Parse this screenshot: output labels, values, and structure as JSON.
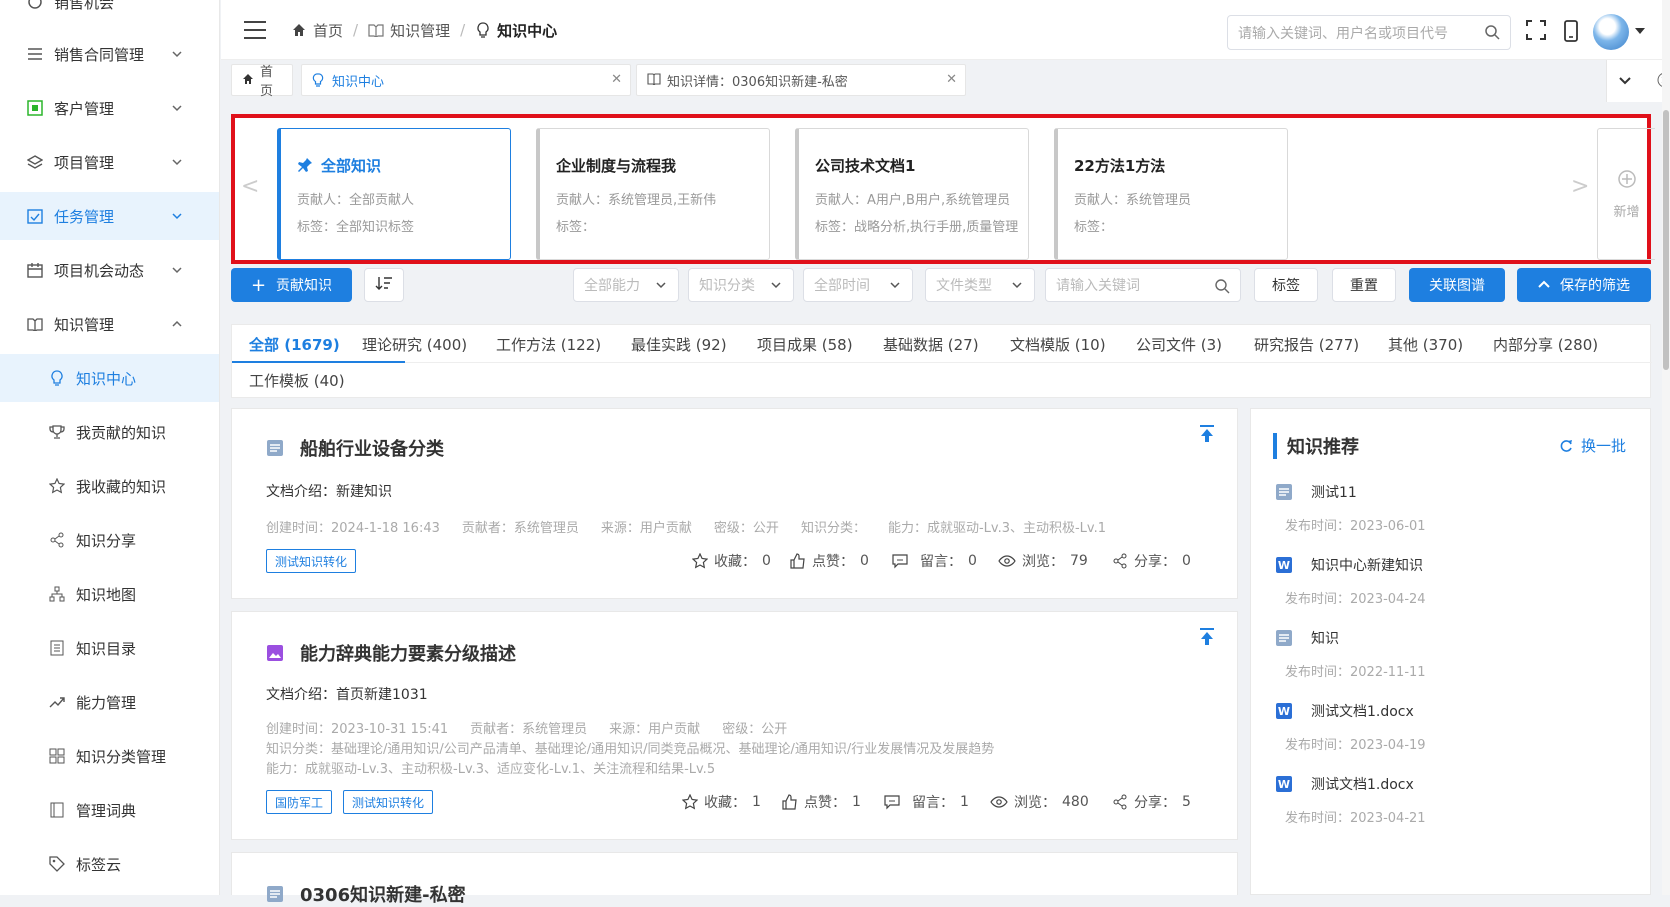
{
  "sidebar": {
    "items": [
      {
        "label": "销售机会",
        "icon": "circle-icon"
      },
      {
        "label": "销售合同管理",
        "icon": "list-icon"
      },
      {
        "label": "客户管理",
        "icon": "customer-icon"
      },
      {
        "label": "项目管理",
        "icon": "layers-icon"
      },
      {
        "label": "任务管理",
        "icon": "task-icon"
      },
      {
        "label": "项目机会动态",
        "icon": "calendar-icon"
      },
      {
        "label": "知识管理",
        "icon": "book-icon"
      }
    ],
    "sub_items": [
      {
        "label": "知识中心",
        "icon": "bulb-icon"
      },
      {
        "label": "我贡献的知识",
        "icon": "trophy-icon"
      },
      {
        "label": "我收藏的知识",
        "icon": "star-icon"
      },
      {
        "label": "知识分享",
        "icon": "share-icon"
      },
      {
        "label": "知识地图",
        "icon": "sitemap-icon"
      },
      {
        "label": "知识目录",
        "icon": "catalog-icon"
      },
      {
        "label": "能力管理",
        "icon": "trend-icon"
      },
      {
        "label": "知识分类管理",
        "icon": "grid-icon"
      },
      {
        "label": "管理词典",
        "icon": "dictionary-icon"
      },
      {
        "label": "标签云",
        "icon": "tag-icon"
      }
    ]
  },
  "header": {
    "breadcrumb": [
      "首页",
      "知识管理",
      "知识中心"
    ],
    "search_placeholder": "请输入关键词、用户名或项目代号"
  },
  "tabs": [
    {
      "label": "首页"
    },
    {
      "label": "知识中心"
    },
    {
      "label": "知识详情：0306知识新建-私密"
    }
  ],
  "knowledge_bases": [
    {
      "title": "全部知识",
      "contributors": "贡献人：全部贡献人",
      "tags": "标签：全部知识标签"
    },
    {
      "title": "企业制度与流程我",
      "contributors": "贡献人：系统管理员,王新伟",
      "tags": "标签："
    },
    {
      "title": "公司技术文档1",
      "contributors": "贡献人：A用户,B用户,系统管理员",
      "tags": "标签：战略分析,执行手册,质量管理"
    },
    {
      "title": "22方法1方法",
      "contributors": "贡献人：系统管理员",
      "tags": "标签："
    }
  ],
  "kb_add_label": "新增",
  "toolbar": {
    "contribute": "贡献知识",
    "ability": "全部能力",
    "category": "知识分类",
    "time": "全部时间",
    "filetype": "文件类型",
    "keyword_placeholder": "请输入关键词",
    "tag": "标签",
    "reset": "重置",
    "graph": "关联图谱",
    "saved_filter": "保存的筛选"
  },
  "categories": [
    "全部 (1679)",
    "理论研究 (400)",
    "工作方法 (122)",
    "最佳实践 (92)",
    "项目成果 (58)",
    "基础数据 (27)",
    "文档模版 (10)",
    "公司文件 (3)",
    "研究报告 (277)",
    "其他 (370)",
    "内部分享 (280)",
    "工作模板 (40)"
  ],
  "articles": [
    {
      "title": "船舶行业设备分类",
      "intro": "文档介绍：新建知识",
      "meta": [
        "创建时间：2024-1-18 16:43",
        "贡献者：系统管理员",
        "来源：用户贡献",
        "密级：公开",
        "知识分类：",
        "能力：成就驱动-Lv.3、主动积极-Lv.1"
      ],
      "tags": [
        "测试知识转化"
      ],
      "stats": {
        "fav_label": "收藏：",
        "fav": "0",
        "like_label": "点赞：",
        "like": "0",
        "comment_label": "留言：",
        "comment": "0",
        "view_label": "浏览：",
        "view": "79",
        "share_label": "分享：",
        "share": "0"
      }
    },
    {
      "title": "能力辞典能力要素分级描述",
      "intro": "文档介绍：首页新建1031",
      "meta": [
        "创建时间：2023-10-31 15:41",
        "贡献者：系统管理员",
        "来源：用户贡献",
        "密级：公开"
      ],
      "meta2": "知识分类：基础理论/通用知识/公司产品清单、基础理论/通用知识/同类竞品概况、基础理论/通用知识/行业发展情况及发展趋势",
      "meta3": "能力：成就驱动-Lv.3、主动积极-Lv.3、适应变化-Lv.1、关注流程和结果-Lv.5",
      "tags": [
        "国防军工",
        "测试知识转化"
      ],
      "stats": {
        "fav_label": "收藏：",
        "fav": "1",
        "like_label": "点赞：",
        "like": "1",
        "comment_label": "留言：",
        "comment": "1",
        "view_label": "浏览：",
        "view": "480",
        "share_label": "分享：",
        "share": "5"
      }
    },
    {
      "title": "0306知识新建-私密"
    }
  ],
  "recommend": {
    "title": "知识推荐",
    "refresh": "换一批",
    "items": [
      {
        "name": "测试11",
        "date": "发布时间：2023-06-01",
        "icon": "doc-icon"
      },
      {
        "name": "知识中心新建知识",
        "date": "发布时间：2023-04-24",
        "icon": "word-icon"
      },
      {
        "name": "知识",
        "date": "发布时间：2022-11-11",
        "icon": "doc-icon"
      },
      {
        "name": "测试文档1.docx",
        "date": "发布时间：2023-04-19",
        "icon": "word-icon"
      },
      {
        "name": "测试文档1.docx",
        "date": "发布时间：2023-04-21",
        "icon": "word-icon"
      }
    ]
  },
  "colors": {
    "accent": "#1e7fe0",
    "highlight_border": "#e0101a"
  }
}
